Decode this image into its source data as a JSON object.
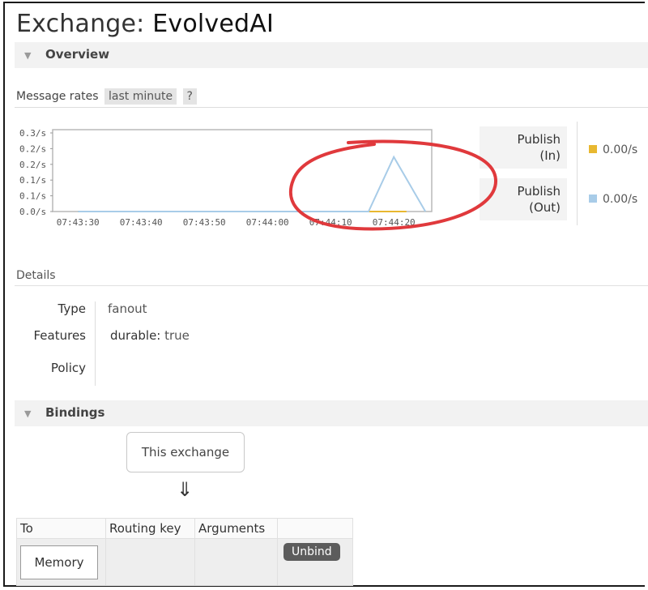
{
  "header": {
    "title_prefix": "Exchange: ",
    "title_name": "EvolvedAI"
  },
  "overview": {
    "label": "Overview"
  },
  "message_rates": {
    "label": "Message rates",
    "range": "last minute",
    "help": "?"
  },
  "chart_data": {
    "type": "line",
    "title": "",
    "xlabel": "",
    "ylabel": "",
    "x": [
      "07:43:30",
      "07:43:40",
      "07:43:50",
      "07:44:00",
      "07:44:10",
      "07:44:20"
    ],
    "y_tick_labels": [
      "0.3/s",
      "0.2/s",
      "0.2/s",
      "0.1/s",
      "0.1/s",
      "0.0/s"
    ],
    "ylim": [
      0,
      0.3
    ],
    "series": [
      {
        "name": "Publish (In)",
        "color": "#e8b830",
        "points": [
          [
            "07:43:30",
            0
          ],
          [
            "07:44:22",
            0
          ]
        ]
      },
      {
        "name": "Publish (Out)",
        "color": "#a8cce8",
        "points": [
          [
            "07:43:30",
            0
          ],
          [
            "07:44:12",
            0
          ],
          [
            "07:44:16",
            0
          ],
          [
            "07:44:20",
            0.2
          ],
          [
            "07:44:25",
            0
          ]
        ]
      }
    ],
    "grid": false
  },
  "legend": [
    {
      "line1": "Publish",
      "line2": "(In)",
      "value": "0.00/s",
      "color": "#e8b830"
    },
    {
      "line1": "Publish",
      "line2": "(Out)",
      "value": "0.00/s",
      "color": "#a8cce8"
    }
  ],
  "details": {
    "label": "Details",
    "type_label": "Type",
    "type_value": "fanout",
    "features_label": "Features",
    "features_key": "durable:",
    "features_value": " true",
    "policy_label": "Policy"
  },
  "bindings": {
    "label": "Bindings",
    "this_exchange": "This exchange",
    "arrow": "⇓",
    "columns": [
      "To",
      "Routing key",
      "Arguments",
      ""
    ],
    "rows": [
      {
        "to": "Memory",
        "routing_key": "",
        "arguments": "",
        "action": "Unbind"
      }
    ]
  },
  "colors": {
    "annotation": "#e0393c",
    "accent_in": "#e8b830",
    "accent_out": "#a8cce8"
  }
}
